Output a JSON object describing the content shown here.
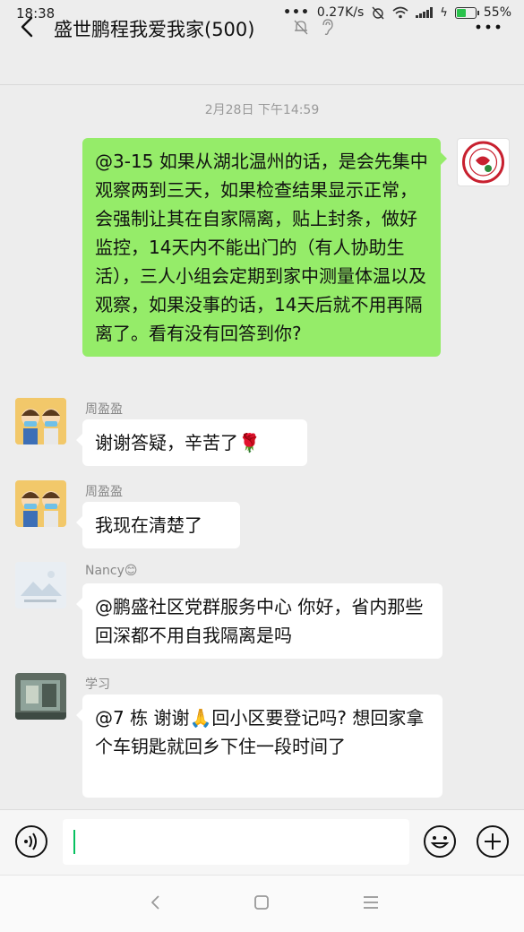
{
  "status_bar": {
    "time": "18:38",
    "net_speed": "0.27K/s",
    "battery": "55%",
    "battery_level": 0.55,
    "battery_color": "#2ac24c"
  },
  "header": {
    "title": "盛世鹏程我爱我家(500)",
    "back_icon": "chevron-left-icon",
    "more_icon": "more-dots-icon"
  },
  "chat": {
    "timestamp": "2月28日 下午14:59",
    "messages": [
      {
        "side": "right",
        "text": "@3-15 如果从湖北温州的话，是会先集中观察两到三天，如果检查结果显示正常，会强制让其在自家隔离，贴上封条，做好监控，14天内不能出门的（有人协助生活），三人小组会定期到家中测量体温以及观察，如果没事的话，14天后就不用再隔离了。看有没有回答到你?"
      },
      {
        "side": "left",
        "sender": "周盈盈",
        "text": "谢谢答疑，辛苦了🌹"
      },
      {
        "side": "left",
        "sender": "周盈盈",
        "text": "我现在清楚了"
      },
      {
        "side": "left",
        "sender": "Nancy😊",
        "text": "@鹏盛社区党群服务中心  你好，省内那些回深都不用自我隔离是吗"
      },
      {
        "side": "left",
        "sender": "学习",
        "text": "@7 栋  谢谢🙏回小区要登记吗? 想回家拿个车钥匙就回乡下住一段时间了"
      }
    ]
  },
  "input": {
    "value": "",
    "accent": "#07c160"
  },
  "colors": {
    "self_bubble": "#95ec69",
    "other_bubble": "#ffffff",
    "background": "#ededed"
  }
}
